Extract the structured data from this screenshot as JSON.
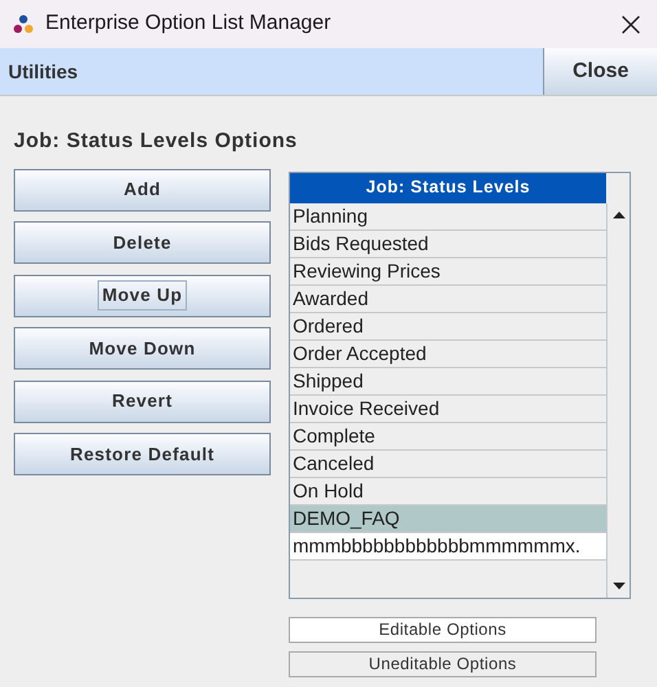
{
  "window": {
    "title": "Enterprise Option List Manager"
  },
  "menu_bar": {
    "label": "Utilities",
    "close_button": "Close"
  },
  "heading": "Job: Status Levels Options",
  "buttons": [
    {
      "label": "Add",
      "focused": false
    },
    {
      "label": "Delete",
      "focused": false
    },
    {
      "label": "Move Up",
      "focused": true
    },
    {
      "label": "Move Down",
      "focused": false
    },
    {
      "label": "Revert",
      "focused": false
    },
    {
      "label": "Restore Default",
      "focused": false
    }
  ],
  "table": {
    "header": "Job: Status Levels",
    "rows": [
      {
        "text": "Planning",
        "editable": false,
        "selected": false
      },
      {
        "text": "Bids Requested",
        "editable": false,
        "selected": false
      },
      {
        "text": "Reviewing Prices",
        "editable": false,
        "selected": false
      },
      {
        "text": "Awarded",
        "editable": false,
        "selected": false
      },
      {
        "text": "Ordered",
        "editable": false,
        "selected": false
      },
      {
        "text": "Order Accepted",
        "editable": false,
        "selected": false
      },
      {
        "text": "Shipped",
        "editable": false,
        "selected": false
      },
      {
        "text": "Invoice Received",
        "editable": false,
        "selected": false
      },
      {
        "text": "Complete",
        "editable": false,
        "selected": false
      },
      {
        "text": "Canceled",
        "editable": false,
        "selected": false
      },
      {
        "text": "On Hold",
        "editable": false,
        "selected": false
      },
      {
        "text": "DEMO_FAQ",
        "selected": true
      },
      {
        "text": "mmmbbbbbbbbbbbbmmmmmmx.",
        "editable": true,
        "selected": false
      }
    ]
  },
  "legend": [
    {
      "label": "Editable Options",
      "editable": true
    },
    {
      "label": "Uneditable Options",
      "editable": false
    }
  ]
}
